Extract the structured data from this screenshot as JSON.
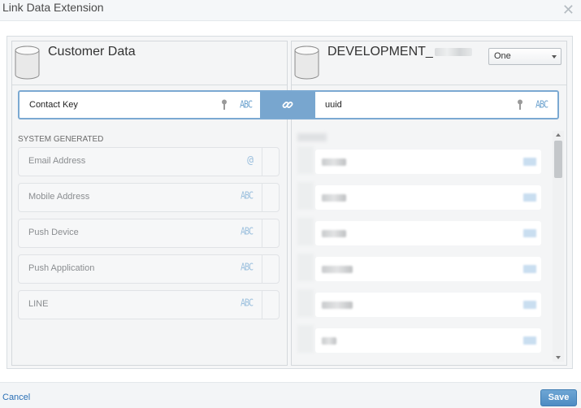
{
  "dialog": {
    "title": "Link Data Extension",
    "close_icon": "close-icon"
  },
  "left_panel": {
    "title": "Customer Data",
    "key_field": {
      "label": "Contact Key",
      "type_label": "ABC"
    },
    "section_label": "SYSTEM GENERATED",
    "fields": [
      {
        "label": "Email Address",
        "type_label": "@"
      },
      {
        "label": "Mobile Address",
        "type_label": "ABC"
      },
      {
        "label": "Push Device",
        "type_label": "ABC"
      },
      {
        "label": "Push Application",
        "type_label": "ABC"
      },
      {
        "label": "LINE",
        "type_label": "ABC"
      }
    ]
  },
  "right_panel": {
    "title": "DEVELOPMENT_",
    "relationship_select": {
      "value": "One"
    },
    "key_field": {
      "label": "uuid",
      "type_label": "ABC"
    }
  },
  "footer": {
    "cancel_label": "Cancel",
    "save_label": "Save"
  },
  "colors": {
    "accent": "#78a6cf",
    "link_text": "#2a6fb5",
    "save_button": "#5b97cb"
  }
}
